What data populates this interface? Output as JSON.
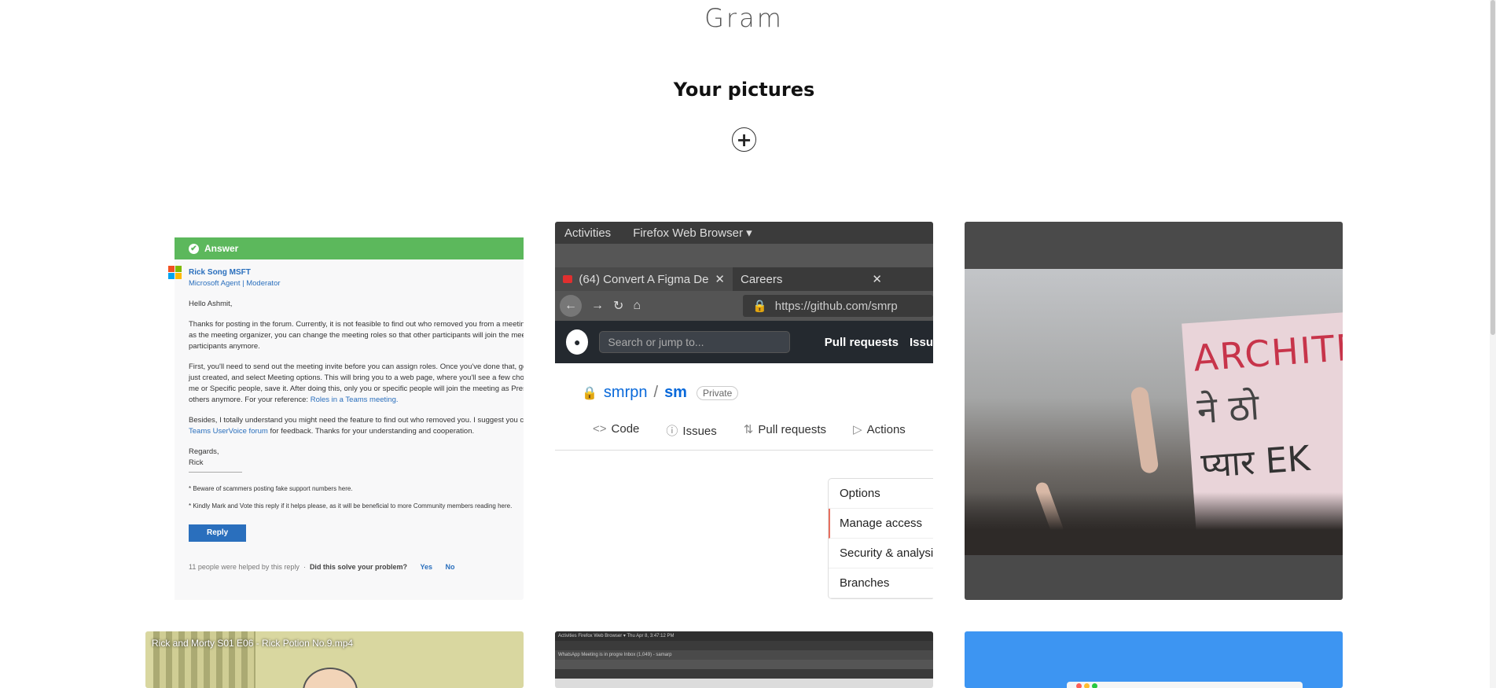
{
  "brand": "Gram",
  "section_title": "Your pictures",
  "add_button": "+",
  "tile1": {
    "answer_label": "Answer",
    "author": "Rick Song MSFT",
    "role": "Microsoft Agent | Moderator",
    "greeting": "Hello Ashmit,",
    "para1_a": "Thanks for posting in the forum. Currently, it is not feasible to find out who removed you from a meeting. B",
    "para1_b": "as the meeting organizer, you can change the meeting roles so that other participants will join the meeting",
    "para1_c": "participants anymore.",
    "para2_a": "First, you'll need to send out the meeting invite before you can assign roles. Once you've done that, go to C",
    "para2_b": "just created, and select Meeting options. This will bring you to a web page, where you'll see a few choices",
    "para2_c": "me or Specific people, save it. After doing this, only you or specific people will join the meeting as Presente",
    "para2_d": "others anymore. For your reference: ",
    "para2_link": "Roles in a Teams meeting.",
    "para3_a": "Besides, I totally understand you might need the feature to find out who removed you. I suggest you can su",
    "para3_link": "Teams UserVoice forum",
    "para3_b": " for feedback. Thanks for your understanding and cooperation.",
    "regards": "Regards,",
    "signoff": "Rick",
    "note1": "* Beware of scammers posting fake support numbers here.",
    "note2": "* Kindly Mark and Vote this reply if it helps please, as it will be beneficial to more Community members reading here.",
    "reply_button": "Reply",
    "helped_text": "11 people were helped by this reply",
    "solve_question": "Did this solve your problem?",
    "yes": "Yes",
    "no": "No"
  },
  "tile2": {
    "activities": "Activities",
    "browser_menu": "Firefox Web Browser ▾",
    "tab1": "(64) Convert A Figma De",
    "tab2": "Careers",
    "url": "https://github.com/smrp",
    "search_placeholder": "Search or jump to...",
    "slash_key": "/",
    "pull_requests": "Pull requests",
    "issues_nav": "Issu",
    "owner": "smrpn",
    "repo": "sm",
    "visibility": "Private",
    "repo_tabs": [
      {
        "icon": "<>",
        "label": "Code"
      },
      {
        "icon": "ⓘ",
        "label": "Issues"
      },
      {
        "icon": "⇅",
        "label": "Pull requests"
      },
      {
        "icon": "▷",
        "label": "Actions"
      }
    ],
    "menu": [
      "Options",
      "Manage access",
      "Security & analysis",
      "Branches"
    ]
  },
  "tile3": {
    "sign_line1": "ARCHITE",
    "sign_line2": "ने ठो",
    "sign_line3": "प्यार EK"
  },
  "tile4": {
    "video_title": "Rick and Morty S01 E06 - Rick Potion No.9.mp4"
  },
  "tile5": {
    "top_text": "Activities  Firefox Web Browser ▾                                    Thu Apr 8, 3:47:12 PM",
    "tab_text": "WhatsApp   Meeting is in progre   Inbox (1,049) - samarp"
  },
  "colors": {
    "answer_green": "#5cb85c",
    "link_blue": "#2a6fbd",
    "github_dark": "#24292f",
    "sky_blue": "#3d95f2"
  }
}
